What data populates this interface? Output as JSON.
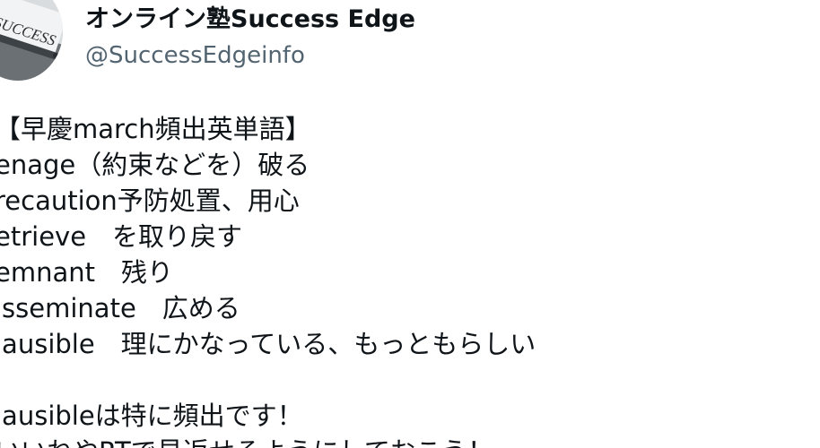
{
  "author": {
    "display_name": "オンライン塾Success Edge",
    "handle": "@SuccessEdgeinfo",
    "avatar_text": "SUCCESS"
  },
  "tweet": {
    "lines": [
      "【早慶march頻出英単語】",
      "enage（約束などを）破る",
      "recaution予防処置、用心",
      "etrieve　を取り戻す",
      "emnant　残り",
      "isseminate　広める",
      "lausible　理にかなっている、もっともらしい",
      "",
      "lausibleは特に頻出です！",
      "いいねやRTで見返せるようにしておこう！"
    ]
  }
}
